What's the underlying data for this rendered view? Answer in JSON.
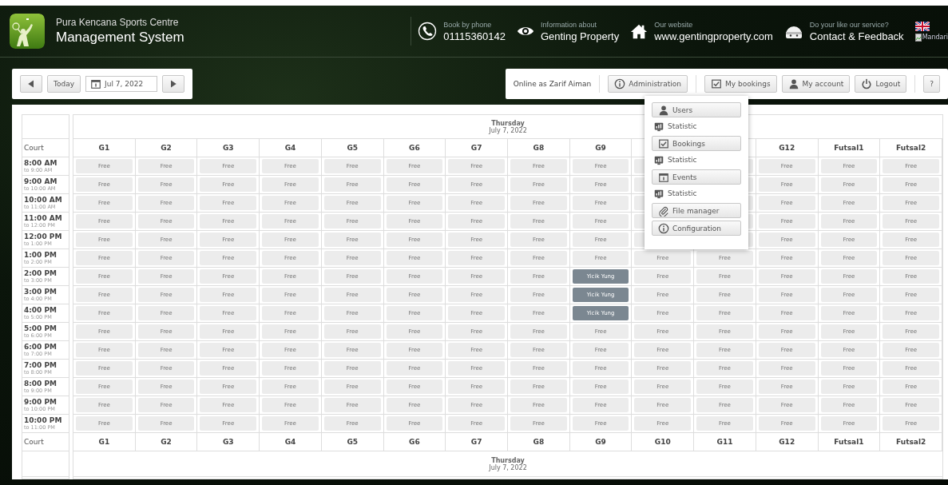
{
  "header": {
    "subtitle": "Pura Kencana Sports Centre",
    "title": "Management System",
    "contacts": [
      {
        "kind": "phone",
        "caption": "Book by phone",
        "value": "01115360142"
      },
      {
        "kind": "eye",
        "caption": "Information about",
        "value": "Genting Property"
      },
      {
        "kind": "home",
        "caption": "Our website",
        "value": "www.gentingproperty.com"
      },
      {
        "kind": "face",
        "caption": "Do your like our service?",
        "value": "Contact & Feedback"
      }
    ],
    "language": "Mandari"
  },
  "date_nav": {
    "today": "Today",
    "date": "Jul 7, 2022"
  },
  "user_bar": {
    "online": "Online as Zarif Aiman",
    "buttons": [
      {
        "kind": "info",
        "label": "Administration"
      },
      {
        "kind": "check",
        "label": "My bookings"
      },
      {
        "kind": "user",
        "label": "My account"
      },
      {
        "kind": "power",
        "label": "Logout"
      },
      {
        "kind": "none",
        "label": "?"
      }
    ]
  },
  "admin_menu": [
    {
      "kind": "button",
      "label": "Users"
    },
    {
      "kind": "link",
      "label": "Statistic"
    },
    {
      "kind": "button",
      "label": "Bookings"
    },
    {
      "kind": "link",
      "label": "Statistic"
    },
    {
      "kind": "button",
      "label": "Events"
    },
    {
      "kind": "link",
      "label": "Statistic"
    },
    {
      "kind": "button",
      "label": "File manager"
    },
    {
      "kind": "button",
      "label": "Configuration"
    }
  ],
  "schedule": {
    "day": "Thursday",
    "date": "July 7, 2022",
    "court_label": "Court",
    "columns": [
      "G1",
      "G2",
      "G3",
      "G4",
      "G5",
      "G6",
      "G7",
      "G8",
      "G9",
      null,
      null,
      "G12",
      "Futsal1",
      "Futsal2"
    ],
    "footer_columns": [
      "G1",
      "G2",
      "G3",
      "G4",
      "G5",
      "G6",
      "G7",
      "G8",
      "G9",
      "G10",
      "G11",
      "G12",
      "Futsal1",
      "Futsal2"
    ],
    "footer_label": "Court",
    "footer_day": "Thursday",
    "footer_date": "July 7, 2022",
    "rows": [
      {
        "time": "8:00 AM",
        "until": "to 9:00 AM",
        "cells": [
          {
            "text": "Free",
            "booked": false
          },
          {
            "text": "Free",
            "booked": false
          },
          {
            "text": "Free",
            "booked": false
          },
          {
            "text": "Free",
            "booked": false
          },
          {
            "text": "Free",
            "booked": false
          },
          {
            "text": "Free",
            "booked": false
          },
          {
            "text": "Free",
            "booked": false
          },
          {
            "text": "Free",
            "booked": false
          },
          {
            "text": "Free",
            "booked": false
          },
          null,
          null,
          {
            "text": "Free",
            "booked": false
          },
          {
            "text": "Free",
            "booked": false
          },
          {
            "text": "Free",
            "booked": false
          }
        ]
      },
      {
        "time": "9:00 AM",
        "until": "to 10:00 AM",
        "cells": [
          {
            "text": "Free",
            "booked": false
          },
          {
            "text": "Free",
            "booked": false
          },
          {
            "text": "Free",
            "booked": false
          },
          {
            "text": "Free",
            "booked": false
          },
          {
            "text": "Free",
            "booked": false
          },
          {
            "text": "Free",
            "booked": false
          },
          {
            "text": "Free",
            "booked": false
          },
          {
            "text": "Free",
            "booked": false
          },
          {
            "text": "Free",
            "booked": false
          },
          null,
          null,
          {
            "text": "Free",
            "booked": false
          },
          {
            "text": "Free",
            "booked": false
          },
          {
            "text": "Free",
            "booked": false
          }
        ]
      },
      {
        "time": "10:00 AM",
        "until": "to 11:00 AM",
        "cells": [
          {
            "text": "Free",
            "booked": false
          },
          {
            "text": "Free",
            "booked": false
          },
          {
            "text": "Free",
            "booked": false
          },
          {
            "text": "Free",
            "booked": false
          },
          {
            "text": "Free",
            "booked": false
          },
          {
            "text": "Free",
            "booked": false
          },
          {
            "text": "Free",
            "booked": false
          },
          {
            "text": "Free",
            "booked": false
          },
          {
            "text": "Free",
            "booked": false
          },
          null,
          null,
          {
            "text": "Free",
            "booked": false
          },
          {
            "text": "Free",
            "booked": false
          },
          {
            "text": "Free",
            "booked": false
          }
        ]
      },
      {
        "time": "11:00 AM",
        "until": "to 12:00 PM",
        "cells": [
          {
            "text": "Free",
            "booked": false
          },
          {
            "text": "Free",
            "booked": false
          },
          {
            "text": "Free",
            "booked": false
          },
          {
            "text": "Free",
            "booked": false
          },
          {
            "text": "Free",
            "booked": false
          },
          {
            "text": "Free",
            "booked": false
          },
          {
            "text": "Free",
            "booked": false
          },
          {
            "text": "Free",
            "booked": false
          },
          {
            "text": "Free",
            "booked": false
          },
          null,
          null,
          {
            "text": "Free",
            "booked": false
          },
          {
            "text": "Free",
            "booked": false
          },
          {
            "text": "Free",
            "booked": false
          }
        ]
      },
      {
        "time": "12:00 PM",
        "until": "to 1:00 PM",
        "cells": [
          {
            "text": "Free",
            "booked": false
          },
          {
            "text": "Free",
            "booked": false
          },
          {
            "text": "Free",
            "booked": false
          },
          {
            "text": "Free",
            "booked": false
          },
          {
            "text": "Free",
            "booked": false
          },
          {
            "text": "Free",
            "booked": false
          },
          {
            "text": "Free",
            "booked": false
          },
          {
            "text": "Free",
            "booked": false
          },
          {
            "text": "Free",
            "booked": false
          },
          null,
          null,
          {
            "text": "Free",
            "booked": false
          },
          {
            "text": "Free",
            "booked": false
          },
          {
            "text": "Free",
            "booked": false
          }
        ]
      },
      {
        "time": "1:00 PM",
        "until": "to 2:00 PM",
        "cells": [
          {
            "text": "Free",
            "booked": false
          },
          {
            "text": "Free",
            "booked": false
          },
          {
            "text": "Free",
            "booked": false
          },
          {
            "text": "Free",
            "booked": false
          },
          {
            "text": "Free",
            "booked": false
          },
          {
            "text": "Free",
            "booked": false
          },
          {
            "text": "Free",
            "booked": false
          },
          {
            "text": "Free",
            "booked": false
          },
          {
            "text": "Free",
            "booked": false
          },
          {
            "text": "Free",
            "booked": false
          },
          {
            "text": "Free",
            "booked": false
          },
          {
            "text": "Free",
            "booked": false
          },
          {
            "text": "Free",
            "booked": false
          },
          {
            "text": "Free",
            "booked": false
          }
        ]
      },
      {
        "time": "2:00 PM",
        "until": "to 3:00 PM",
        "cells": [
          {
            "text": "Free",
            "booked": false
          },
          {
            "text": "Free",
            "booked": false
          },
          {
            "text": "Free",
            "booked": false
          },
          {
            "text": "Free",
            "booked": false
          },
          {
            "text": "Free",
            "booked": false
          },
          {
            "text": "Free",
            "booked": false
          },
          {
            "text": "Free",
            "booked": false
          },
          {
            "text": "Free",
            "booked": false
          },
          {
            "text": "Yicik Yung",
            "booked": true
          },
          {
            "text": "Free",
            "booked": false
          },
          {
            "text": "Free",
            "booked": false
          },
          {
            "text": "Free",
            "booked": false
          },
          {
            "text": "Free",
            "booked": false
          },
          {
            "text": "Free",
            "booked": false
          }
        ]
      },
      {
        "time": "3:00 PM",
        "until": "to 4:00 PM",
        "cells": [
          {
            "text": "Free",
            "booked": false
          },
          {
            "text": "Free",
            "booked": false
          },
          {
            "text": "Free",
            "booked": false
          },
          {
            "text": "Free",
            "booked": false
          },
          {
            "text": "Free",
            "booked": false
          },
          {
            "text": "Free",
            "booked": false
          },
          {
            "text": "Free",
            "booked": false
          },
          {
            "text": "Free",
            "booked": false
          },
          {
            "text": "Yicik Yung",
            "booked": true
          },
          {
            "text": "Free",
            "booked": false
          },
          {
            "text": "Free",
            "booked": false
          },
          {
            "text": "Free",
            "booked": false
          },
          {
            "text": "Free",
            "booked": false
          },
          {
            "text": "Free",
            "booked": false
          }
        ]
      },
      {
        "time": "4:00 PM",
        "until": "to 5:00 PM",
        "cells": [
          {
            "text": "Free",
            "booked": false
          },
          {
            "text": "Free",
            "booked": false
          },
          {
            "text": "Free",
            "booked": false
          },
          {
            "text": "Free",
            "booked": false
          },
          {
            "text": "Free",
            "booked": false
          },
          {
            "text": "Free",
            "booked": false
          },
          {
            "text": "Free",
            "booked": false
          },
          {
            "text": "Free",
            "booked": false
          },
          {
            "text": "Yicik Yung",
            "booked": true
          },
          {
            "text": "Free",
            "booked": false
          },
          {
            "text": "Free",
            "booked": false
          },
          {
            "text": "Free",
            "booked": false
          },
          {
            "text": "Free",
            "booked": false
          },
          {
            "text": "Free",
            "booked": false
          }
        ]
      },
      {
        "time": "5:00 PM",
        "until": "to 6:00 PM",
        "cells": [
          {
            "text": "Free",
            "booked": false
          },
          {
            "text": "Free",
            "booked": false
          },
          {
            "text": "Free",
            "booked": false
          },
          {
            "text": "Free",
            "booked": false
          },
          {
            "text": "Free",
            "booked": false
          },
          {
            "text": "Free",
            "booked": false
          },
          {
            "text": "Free",
            "booked": false
          },
          {
            "text": "Free",
            "booked": false
          },
          {
            "text": "Free",
            "booked": false
          },
          {
            "text": "Free",
            "booked": false
          },
          {
            "text": "Free",
            "booked": false
          },
          {
            "text": "Free",
            "booked": false
          },
          {
            "text": "Free",
            "booked": false
          },
          {
            "text": "Free",
            "booked": false
          }
        ]
      },
      {
        "time": "6:00 PM",
        "until": "to 7:00 PM",
        "cells": [
          {
            "text": "Free",
            "booked": false
          },
          {
            "text": "Free",
            "booked": false
          },
          {
            "text": "Free",
            "booked": false
          },
          {
            "text": "Free",
            "booked": false
          },
          {
            "text": "Free",
            "booked": false
          },
          {
            "text": "Free",
            "booked": false
          },
          {
            "text": "Free",
            "booked": false
          },
          {
            "text": "Free",
            "booked": false
          },
          {
            "text": "Free",
            "booked": false
          },
          {
            "text": "Free",
            "booked": false
          },
          {
            "text": "Free",
            "booked": false
          },
          {
            "text": "Free",
            "booked": false
          },
          {
            "text": "Free",
            "booked": false
          },
          {
            "text": "Free",
            "booked": false
          }
        ]
      },
      {
        "time": "7:00 PM",
        "until": "to 8:00 PM",
        "cells": [
          {
            "text": "Free",
            "booked": false
          },
          {
            "text": "Free",
            "booked": false
          },
          {
            "text": "Free",
            "booked": false
          },
          {
            "text": "Free",
            "booked": false
          },
          {
            "text": "Free",
            "booked": false
          },
          {
            "text": "Free",
            "booked": false
          },
          {
            "text": "Free",
            "booked": false
          },
          {
            "text": "Free",
            "booked": false
          },
          {
            "text": "Free",
            "booked": false
          },
          {
            "text": "Free",
            "booked": false
          },
          {
            "text": "Free",
            "booked": false
          },
          {
            "text": "Free",
            "booked": false
          },
          {
            "text": "Free",
            "booked": false
          },
          {
            "text": "Free",
            "booked": false
          }
        ]
      },
      {
        "time": "8:00 PM",
        "until": "to 9:00 PM",
        "cells": [
          {
            "text": "Free",
            "booked": false
          },
          {
            "text": "Free",
            "booked": false
          },
          {
            "text": "Free",
            "booked": false
          },
          {
            "text": "Free",
            "booked": false
          },
          {
            "text": "Free",
            "booked": false
          },
          {
            "text": "Free",
            "booked": false
          },
          {
            "text": "Free",
            "booked": false
          },
          {
            "text": "Free",
            "booked": false
          },
          {
            "text": "Free",
            "booked": false
          },
          {
            "text": "Free",
            "booked": false
          },
          {
            "text": "Free",
            "booked": false
          },
          {
            "text": "Free",
            "booked": false
          },
          {
            "text": "Free",
            "booked": false
          },
          {
            "text": "Free",
            "booked": false
          }
        ]
      },
      {
        "time": "9:00 PM",
        "until": "to 10:00 PM",
        "cells": [
          {
            "text": "Free",
            "booked": false
          },
          {
            "text": "Free",
            "booked": false
          },
          {
            "text": "Free",
            "booked": false
          },
          {
            "text": "Free",
            "booked": false
          },
          {
            "text": "Free",
            "booked": false
          },
          {
            "text": "Free",
            "booked": false
          },
          {
            "text": "Free",
            "booked": false
          },
          {
            "text": "Free",
            "booked": false
          },
          {
            "text": "Free",
            "booked": false
          },
          {
            "text": "Free",
            "booked": false
          },
          {
            "text": "Free",
            "booked": false
          },
          {
            "text": "Free",
            "booked": false
          },
          {
            "text": "Free",
            "booked": false
          },
          {
            "text": "Free",
            "booked": false
          }
        ]
      },
      {
        "time": "10:00 PM",
        "until": "to 11:00 PM",
        "cells": [
          {
            "text": "Free",
            "booked": false
          },
          {
            "text": "Free",
            "booked": false
          },
          {
            "text": "Free",
            "booked": false
          },
          {
            "text": "Free",
            "booked": false
          },
          {
            "text": "Free",
            "booked": false
          },
          {
            "text": "Free",
            "booked": false
          },
          {
            "text": "Free",
            "booked": false
          },
          {
            "text": "Free",
            "booked": false
          },
          {
            "text": "Free",
            "booked": false
          },
          {
            "text": "Free",
            "booked": false
          },
          {
            "text": "Free",
            "booked": false
          },
          {
            "text": "Free",
            "booked": false
          },
          {
            "text": "Free",
            "booked": false
          },
          {
            "text": "Free",
            "booked": false
          }
        ]
      }
    ]
  }
}
